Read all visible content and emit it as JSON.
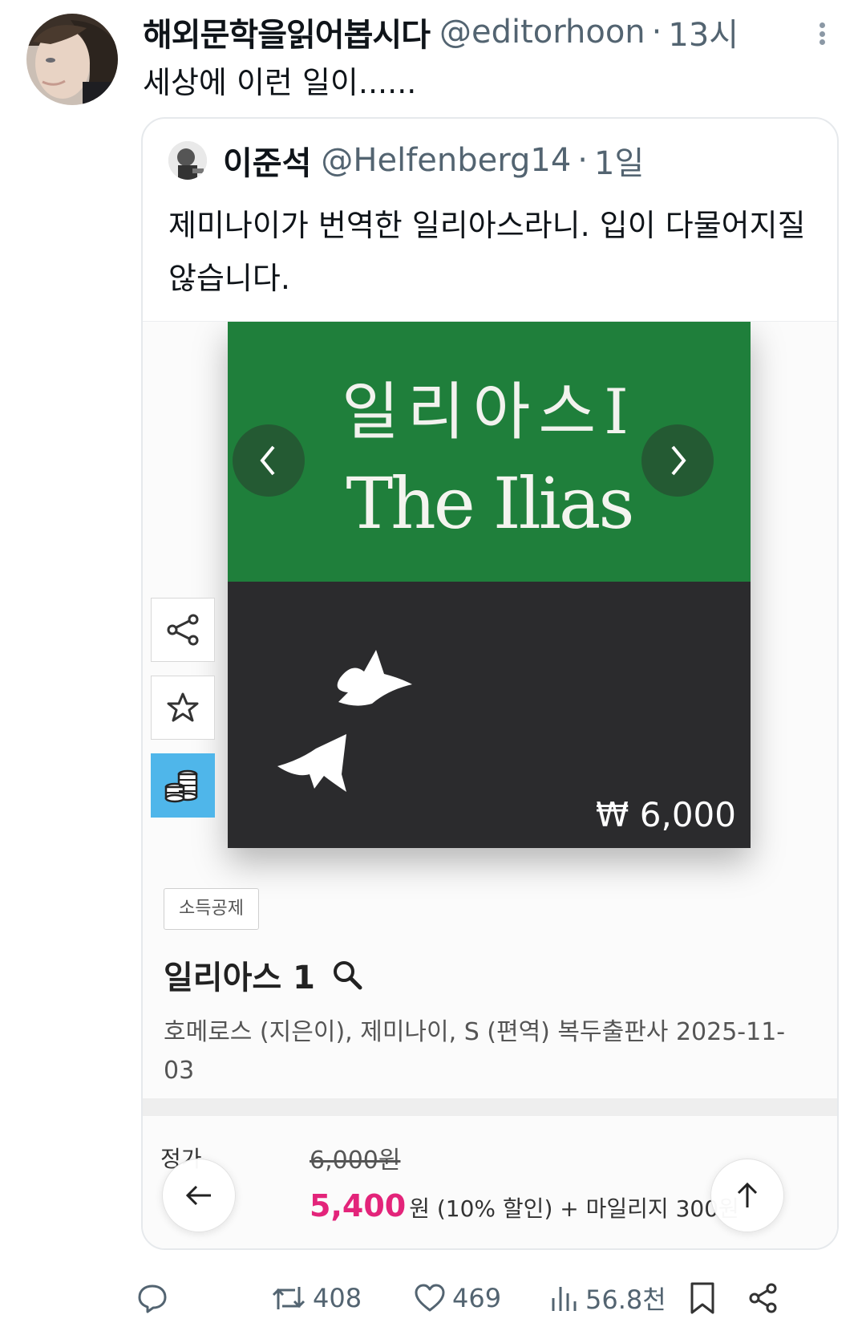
{
  "tweet": {
    "author_name": "해외문학을읽어봅시다",
    "author_handle": "@editorhoon",
    "separator": "·",
    "time": "13시",
    "text": "세상에 이런 일이......"
  },
  "quote": {
    "author_name": "이준석",
    "author_handle": "@Helfenberg14",
    "separator": "·",
    "time": "1일",
    "text": "제미나이가 번역한 일리아스라니. 입이 다물어지질 않습니다."
  },
  "product": {
    "cover_title_ko": "일리아스I",
    "cover_title_en": "The Ilias",
    "cover_price": "₩ 6,000",
    "tag": "소득공제",
    "title": "일리아스 1",
    "meta": "호메로스 (지은이), 제미나이, S (편역)   복두출판사   2025-11-03",
    "list_price_label": "정가",
    "list_price": "6,000원",
    "sale_price": "5,400",
    "sale_rest": "원 (10% 할인) + 마일리지 300원"
  },
  "actions": {
    "reply_count": "",
    "retweet_count": "408",
    "like_count": "469",
    "view_count": "56.8천"
  },
  "colors": {
    "accent_pink": "#e3247a",
    "cover_green": "#1f7f3b",
    "cover_dark": "#2b2b2d",
    "coin_blue": "#4fb6ea",
    "muted": "#536471"
  }
}
